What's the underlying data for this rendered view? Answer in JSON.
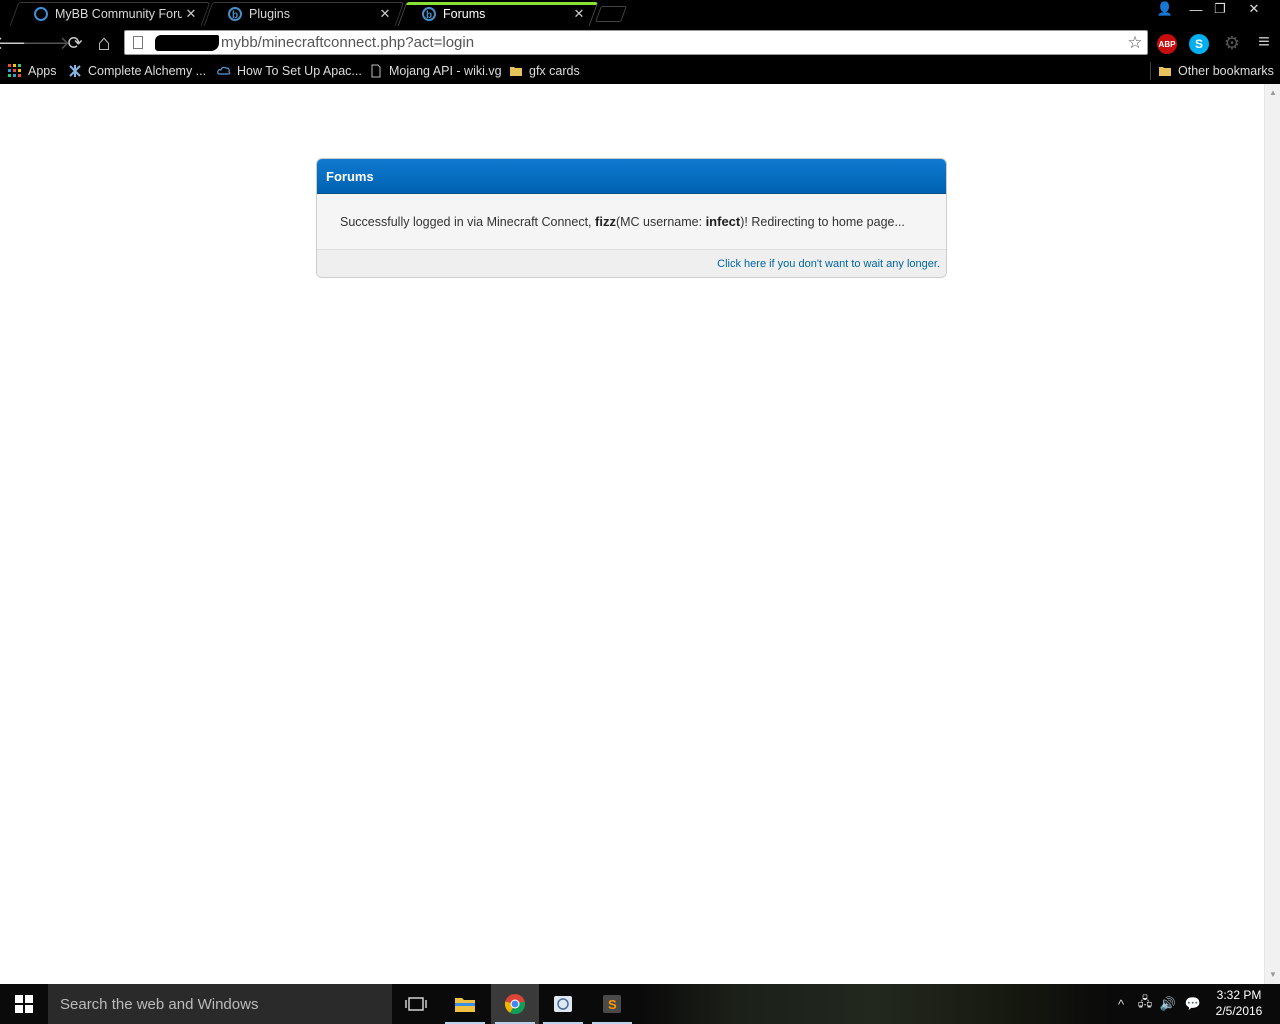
{
  "browser": {
    "tabs": [
      {
        "title": "MyBB Community Forums",
        "active": false
      },
      {
        "title": "Plugins",
        "active": false
      },
      {
        "title": "Forums",
        "active": true
      }
    ],
    "tab_close_glyph": "✕",
    "window_controls": {
      "user": "👤",
      "minimize": "—",
      "restore": "❐",
      "close": "✕"
    },
    "toolbar": {
      "back": "🡐",
      "forward": "🡒",
      "reload": "⟳",
      "home": "⌂",
      "url": "mybb/minecraftconnect.php?act=login",
      "bookmark_star": "☆",
      "extensions": [
        {
          "name": "ABP",
          "color": "#c70d0d"
        },
        {
          "name": "S",
          "color": "#00aff0"
        }
      ],
      "settings_glyph": "⚙",
      "menu_glyph": "≡"
    },
    "bookmarks": [
      {
        "label": "Apps"
      },
      {
        "label": "Complete Alchemy ..."
      },
      {
        "label": "How To Set Up Apac..."
      },
      {
        "label": "Mojang API - wiki.vg"
      },
      {
        "label": "gfx cards"
      }
    ],
    "other_bookmarks": "Other bookmarks"
  },
  "page": {
    "box_title": "Forums",
    "message_before_name": "Successfully logged in via Minecraft Connect, ",
    "user_name": "fizz",
    "message_mid": "(MC username: ",
    "mc_username": "infect",
    "message_after": ")! Redirecting to home page...",
    "redirect_link": "Click here if you don't want to wait any longer."
  },
  "taskbar": {
    "search_placeholder": "Search the web and Windows",
    "tray": {
      "chevron": "^",
      "network": "🖧",
      "volume": "🔊",
      "notifications": "💬"
    },
    "time": "3:32 PM",
    "date": "2/5/2016"
  }
}
